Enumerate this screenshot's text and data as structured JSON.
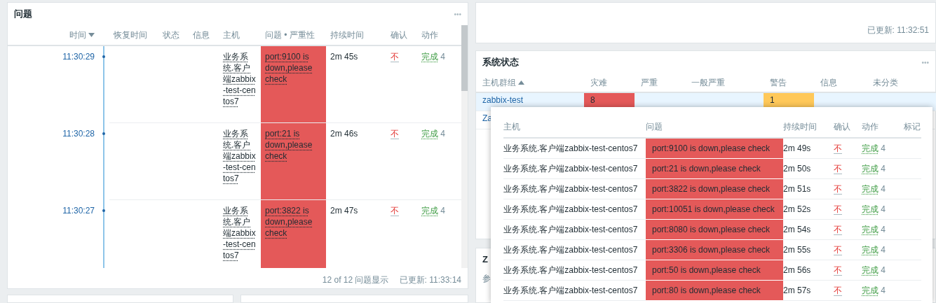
{
  "problems_panel": {
    "title": "问题",
    "menu": "•••",
    "columns": [
      {
        "label": "时间",
        "sorted": true,
        "descending": true
      },
      {
        "label": "恢复时间"
      },
      {
        "label": "状态"
      },
      {
        "label": "信息"
      },
      {
        "label": "主机"
      },
      {
        "label": "问题 • 严重性"
      },
      {
        "label": "持续时间"
      },
      {
        "label": "确认"
      },
      {
        "label": "动作"
      }
    ],
    "rows": [
      {
        "time": "11:30:29",
        "host": "业务系统.客户端zabbix-test-centos7",
        "problem": "port:9100 is down,please check",
        "color": "#e45959",
        "duration": "2m 45s",
        "ack": "不",
        "actions": "完成",
        "action_count": "4"
      },
      {
        "time": "11:30:28",
        "host": "业务系统.客户端zabbix-test-centos7",
        "problem": "port:21 is down,please check",
        "color": "#e45959",
        "duration": "2m 46s",
        "ack": "不",
        "actions": "完成",
        "action_count": "4"
      },
      {
        "time": "11:30:27",
        "host": "业务系统.客户端zabbix-test-centos7",
        "problem": "port:3822 is down,please check",
        "color": "#e45959",
        "duration": "2m 47s",
        "ack": "不",
        "actions": "完成",
        "action_count": "4"
      }
    ],
    "count": "12 of 12 问题显示",
    "updated": "已更新: 11:33:14"
  },
  "top_right_panel": {
    "updated": "已更新: 11:32:51"
  },
  "system_status": {
    "title": "系统状态",
    "menu": "•••",
    "columns": [
      {
        "label": "主机群组",
        "sorted": true,
        "descending": false
      },
      {
        "label": "灾难"
      },
      {
        "label": "严重"
      },
      {
        "label": "一般严重"
      },
      {
        "label": "警告"
      },
      {
        "label": "信息"
      },
      {
        "label": "未分类"
      }
    ],
    "rows": [
      {
        "group": "zabbix-test",
        "highlighted": true,
        "disaster": {
          "count": "8",
          "color": "#e45959"
        },
        "warning": {
          "count": "1",
          "color": "#ffc859"
        }
      },
      {
        "group": "Za",
        "highlighted": false
      }
    ]
  },
  "lower_right_panel": {
    "title": "Z",
    "text": "参"
  },
  "popup": {
    "columns": [
      "主机",
      "问题",
      "持续时间",
      "确认",
      "动作",
      "标记"
    ],
    "rows": [
      {
        "host": "业务系统.客户端zabbix-test-centos7",
        "problem": "port:9100 is down,please check",
        "color": "#e45959",
        "duration": "2m 49s",
        "ack": "不",
        "actions": "完成",
        "action_count": "4"
      },
      {
        "host": "业务系统.客户端zabbix-test-centos7",
        "problem": "port:21 is down,please check",
        "color": "#e45959",
        "duration": "2m 50s",
        "ack": "不",
        "actions": "完成",
        "action_count": "4"
      },
      {
        "host": "业务系统.客户端zabbix-test-centos7",
        "problem": "port:3822 is down,please check",
        "color": "#e45959",
        "duration": "2m 51s",
        "ack": "不",
        "actions": "完成",
        "action_count": "4"
      },
      {
        "host": "业务系统.客户端zabbix-test-centos7",
        "problem": "port:10051 is down,please check",
        "color": "#e45959",
        "duration": "2m 52s",
        "ack": "不",
        "actions": "完成",
        "action_count": "4"
      },
      {
        "host": "业务系统.客户端zabbix-test-centos7",
        "problem": "port:8080 is down,please check",
        "color": "#e45959",
        "duration": "2m 54s",
        "ack": "不",
        "actions": "完成",
        "action_count": "4"
      },
      {
        "host": "业务系统.客户端zabbix-test-centos7",
        "problem": "port:3306 is down,please check",
        "color": "#e45959",
        "duration": "2m 55s",
        "ack": "不",
        "actions": "完成",
        "action_count": "4"
      },
      {
        "host": "业务系统.客户端zabbix-test-centos7",
        "problem": "port:50 is down,please check",
        "color": "#e45959",
        "duration": "2m 56s",
        "ack": "不",
        "actions": "完成",
        "action_count": "4"
      },
      {
        "host": "业务系统.客户端zabbix-test-centos7",
        "problem": "port:80 is down,please check",
        "color": "#e45959",
        "duration": "2m 57s",
        "ack": "不",
        "actions": "完成",
        "action_count": "4"
      }
    ]
  }
}
